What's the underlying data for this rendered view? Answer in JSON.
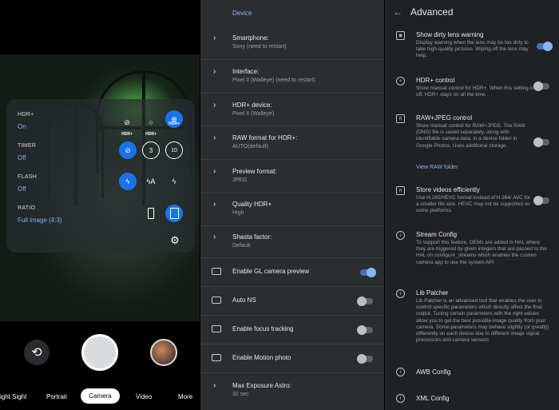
{
  "camera": {
    "settings": [
      {
        "label": "HDR+",
        "value": "On"
      },
      {
        "label": "TIMER",
        "value": "Off"
      },
      {
        "label": "FLASH",
        "value": "Off"
      },
      {
        "label": "RATIO",
        "value": "Full image (4:3)"
      }
    ],
    "hdr_labels": [
      "HDR+",
      "HDR+",
      "HDR+"
    ],
    "timer_labels": [
      "3",
      "10"
    ],
    "modes": [
      "ight Sight",
      "Portrait",
      "Camera",
      "Video",
      "More"
    ],
    "active_mode": "Camera"
  },
  "settings_list": {
    "header": "Device",
    "items": [
      {
        "title": "Smartphone:",
        "sub": "Sony (need to restart)"
      },
      {
        "title": "Interface:",
        "sub": "Pixel II (Walleye) (need to restart)"
      },
      {
        "title": "HDR+ device:",
        "sub": "Pixel II (Walleye)"
      },
      {
        "title": "RAW format for HDR+:",
        "sub": "AUTO(default)"
      },
      {
        "title": "Preview format:",
        "sub": "JPEG"
      },
      {
        "title": "Quality HDR+",
        "sub": "High"
      },
      {
        "title": "Shasta factor:",
        "sub": "Default"
      }
    ],
    "toggles": [
      {
        "title": "Enable GL camera preview",
        "on": true
      },
      {
        "title": "Auto NS",
        "on": false
      },
      {
        "title": "Enable focus tracking",
        "on": false
      },
      {
        "title": "Enable Motion photo",
        "on": false
      }
    ],
    "last": {
      "title": "Max Exposure Astro:",
      "sub": "32 sec"
    }
  },
  "advanced": {
    "title": "Advanced",
    "items": [
      {
        "title": "Show dirty lens warning",
        "desc": "Display warning when the lens may be too dirty to take high-quality pictures. Wiping off the lens may help.",
        "toggle": true
      },
      {
        "title": "HDR+ control",
        "desc": "Show manual control for HDR+. When this setting is off, HDR+ stays on all the time.",
        "toggle": false
      },
      {
        "title": "RAW+JPEG control",
        "desc": "Show manual control for RAW+JPEG. The RAW (DNG) file is saved separately, along with identifiable camera data, in a device folder in Google Photos. Uses additional storage.",
        "toggle": false,
        "link": "View RAW folder"
      },
      {
        "title": "Store videos efficiently",
        "desc": "Use H.265/HEVC format instead of H.264/ AVC for a smaller file size. HEVC may not be supported on some platforms.",
        "toggle": false
      },
      {
        "title": "Stream Config",
        "desc": "To support this feature, OEMs are added in HAL where they are triggered by given integers that are passed to the HAL on configure_streams which enables the custom camera app to use the system API"
      },
      {
        "title": "Lib Patcher",
        "desc": "Lib Patcher is an advanced tool that enables the user to control specific parameters which directly affect the final output. Tuning certain parameters with the right values allow you to get the best possible image quality from your camera. Some parameters may behave slightly (or greatly) differently on each device due to different image signal processors and camera sensors"
      },
      {
        "title": "AWB Config"
      },
      {
        "title": "XML Config"
      }
    ]
  },
  "colors": {
    "accent": "#8ab4f8",
    "selected_blue": "#1a73e8"
  }
}
